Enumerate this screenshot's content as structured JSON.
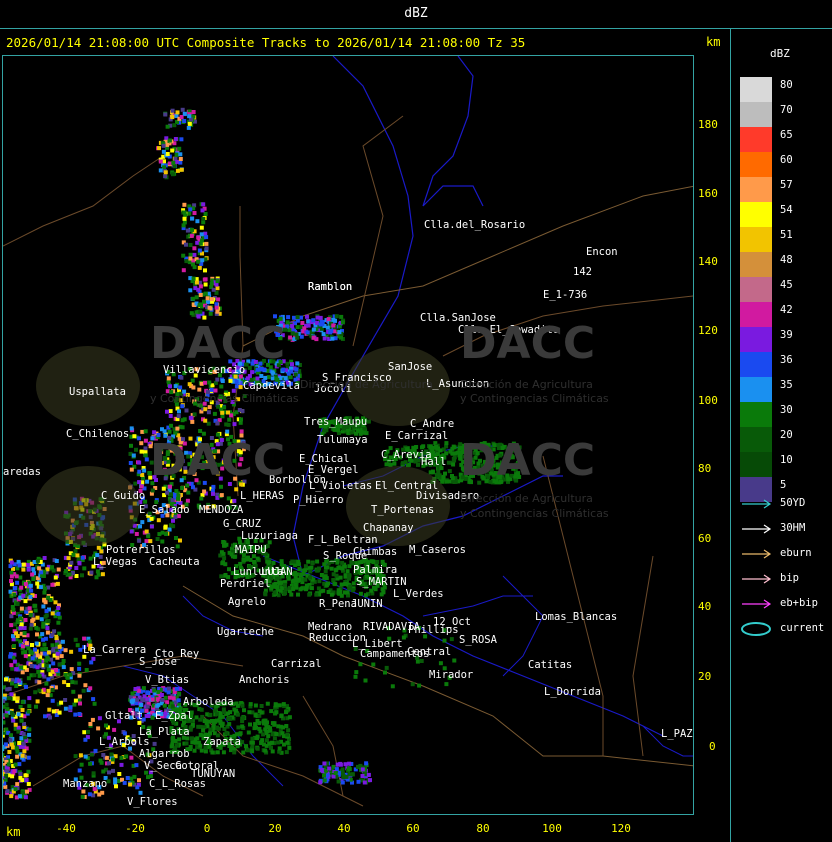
{
  "title": "dBZ",
  "header": "2026/01/14 21:08:00 UTC Composite Tracks to 2026/01/14 21:08:00 Tz 35",
  "km_label": "km",
  "legend": {
    "title": "dBZ",
    "entries": [
      {
        "value": "80",
        "color": "#d9d9d9"
      },
      {
        "value": "70",
        "color": "#bdbdbd"
      },
      {
        "value": "65",
        "color": "#ff3a2a"
      },
      {
        "value": "60",
        "color": "#ff6a00"
      },
      {
        "value": "57",
        "color": "#ff9a4a"
      },
      {
        "value": "54",
        "color": "#ffff00"
      },
      {
        "value": "51",
        "color": "#f2c400"
      },
      {
        "value": "48",
        "color": "#d4903a"
      },
      {
        "value": "45",
        "color": "#c3698a"
      },
      {
        "value": "42",
        "color": "#d11aa0"
      },
      {
        "value": "39",
        "color": "#7a1ae0"
      },
      {
        "value": "36",
        "color": "#1a4af0"
      },
      {
        "value": "35",
        "color": "#1a90f0"
      },
      {
        "value": "30",
        "color": "#0a7a0a"
      },
      {
        "value": "20",
        "color": "#085a08"
      },
      {
        "value": "10",
        "color": "#064a06"
      },
      {
        "value": "5",
        "color": "#483a8a"
      }
    ]
  },
  "tracks": [
    {
      "label": "50YD",
      "color": "#33cccc"
    },
    {
      "label": "30HM",
      "color": "#ffffff"
    },
    {
      "label": "eburn",
      "color": "#e8b86a"
    },
    {
      "label": "bip",
      "color": "#ffc0d0"
    },
    {
      "label": "eb+bip",
      "color": "#ff40ff"
    },
    {
      "label": "current",
      "color": "#33cccc"
    }
  ],
  "y_ticks": [
    "180",
    "160",
    "140",
    "120",
    "100",
    "80",
    "60",
    "40",
    "20",
    "0"
  ],
  "x_ticks": [
    "-40",
    "-20",
    "0",
    "20",
    "40",
    "60",
    "80",
    "100",
    "120"
  ],
  "places": [
    {
      "name": "Clla.del_Rosario"
    },
    {
      "name": "Encon"
    },
    {
      "name": "142"
    },
    {
      "name": "E_1-736"
    },
    {
      "name": "Ramblon"
    },
    {
      "name": "Clla.SanJose"
    },
    {
      "name": "Clla.El_Cowadito"
    },
    {
      "name": "Villavicencio"
    },
    {
      "name": "Capdevila"
    },
    {
      "name": "S_Francisco"
    },
    {
      "name": "Jocoli"
    },
    {
      "name": "SanJose"
    },
    {
      "name": "L_Asuncion"
    },
    {
      "name": "Uspallata"
    },
    {
      "name": "Tres_Maupu"
    },
    {
      "name": "C_Andre"
    },
    {
      "name": "C_Chilenos"
    },
    {
      "name": "Tulumaya"
    },
    {
      "name": "E_Carrizal"
    },
    {
      "name": "C_Arevia"
    },
    {
      "name": "E_Chical"
    },
    {
      "name": "E_Vergel"
    },
    {
      "name": "Hall"
    },
    {
      "name": "aredas"
    },
    {
      "name": "Borbollon"
    },
    {
      "name": "L_Violetas"
    },
    {
      "name": "El_Central"
    },
    {
      "name": "Divisadero"
    },
    {
      "name": "C_Guido"
    },
    {
      "name": "L_HERAS"
    },
    {
      "name": "P_Hierro"
    },
    {
      "name": "E_Salado"
    },
    {
      "name": "MENDOZA"
    },
    {
      "name": "T_Portenas"
    },
    {
      "name": "G_CRUZ"
    },
    {
      "name": "Chapanay"
    },
    {
      "name": "Luzuriaga"
    },
    {
      "name": "F_L_Beltran"
    },
    {
      "name": "Potrerillos"
    },
    {
      "name": "MAIPU"
    },
    {
      "name": "S_Roque"
    },
    {
      "name": "Chimbas"
    },
    {
      "name": "M_Caseros"
    },
    {
      "name": "L_Vegas"
    },
    {
      "name": "Cacheuta"
    },
    {
      "name": "LUJAN"
    },
    {
      "name": "Lunlunta"
    },
    {
      "name": "Palmira"
    },
    {
      "name": "S_MARTIN"
    },
    {
      "name": "Perdriel"
    },
    {
      "name": "L_Verdes"
    },
    {
      "name": "Agrelo"
    },
    {
      "name": "R_Pena"
    },
    {
      "name": "JUNIN"
    },
    {
      "name": "Ramblon"
    },
    {
      "name": "Ugarteche"
    },
    {
      "name": "Medrano"
    },
    {
      "name": "RIVADAVIA"
    },
    {
      "name": "Reduccion"
    },
    {
      "name": "12_Oct"
    },
    {
      "name": "Phillips"
    },
    {
      "name": "Lomas_Blancas"
    },
    {
      "name": "L_Libert"
    },
    {
      "name": "S_ROSA"
    },
    {
      "name": "Campamentos"
    },
    {
      "name": "Central"
    },
    {
      "name": "La_Carrera"
    },
    {
      "name": "Cto_Rey"
    },
    {
      "name": "S_Jose"
    },
    {
      "name": "Carrizal"
    },
    {
      "name": "Catitas"
    },
    {
      "name": "Mirador"
    },
    {
      "name": "V_Btias"
    },
    {
      "name": "Anchoris"
    },
    {
      "name": "L_Dorrida"
    },
    {
      "name": "Arboleda"
    },
    {
      "name": "Gltalt"
    },
    {
      "name": "E_Zpal"
    },
    {
      "name": "La_Plata"
    },
    {
      "name": "L_Arbols"
    },
    {
      "name": "Zapata"
    },
    {
      "name": "L_PAZ"
    },
    {
      "name": "Algarrob"
    },
    {
      "name": "V_Seca"
    },
    {
      "name": "Cotoral"
    },
    {
      "name": "TUNUYAN"
    },
    {
      "name": "Manzano"
    },
    {
      "name": "C_L_Rosas"
    },
    {
      "name": "V_Flores"
    }
  ],
  "watermark": {
    "brand": "DACC",
    "subtitle_1": "Dirección de Agricultura",
    "subtitle_2": "y Contingencias Climáticas"
  }
}
